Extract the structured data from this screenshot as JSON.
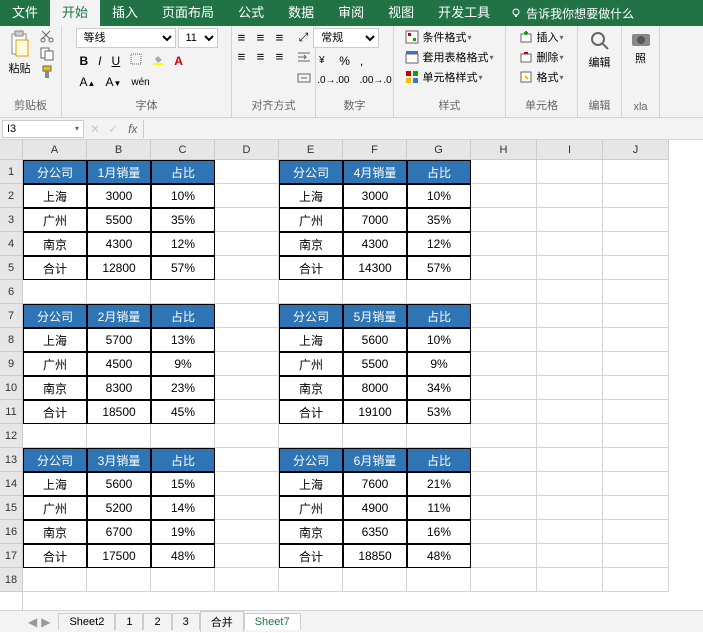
{
  "tabs": {
    "file": "文件",
    "home": "开始",
    "insert": "插入",
    "page": "页面布局",
    "formula": "公式",
    "data": "数据",
    "review": "审阅",
    "view": "视图",
    "dev": "开发工具",
    "tellme": "告诉我你想要做什么"
  },
  "groups": {
    "clipboard": "剪贴板",
    "font": "字体",
    "align": "对齐方式",
    "number": "数字",
    "styles": "样式",
    "cells": "单元格",
    "edit": "编辑",
    "xla": "xla"
  },
  "ribbon": {
    "paste": "粘贴",
    "font_name": "等线",
    "font_size": "11",
    "number_format": "常规",
    "cond_format": "条件格式",
    "table_format": "套用表格格式",
    "cell_styles": "单元格样式",
    "insert": "插入",
    "delete": "删除",
    "format": "格式",
    "edit": "编辑",
    "photo": "照"
  },
  "namebox": "I3",
  "colW": {
    "A": 64,
    "B": 64,
    "C": 64,
    "D": 64,
    "E": 64,
    "F": 64,
    "G": 64,
    "H": 66,
    "I": 66,
    "J": 66
  },
  "cols": [
    "A",
    "B",
    "C",
    "D",
    "E",
    "F",
    "G",
    "H",
    "I",
    "J"
  ],
  "rowCount": 18,
  "headers": {
    "company": "分公司",
    "sales1": "1月销量",
    "sales2": "2月销量",
    "sales3": "3月销量",
    "sales4": "4月销量",
    "sales5": "5月销量",
    "sales6": "6月销量",
    "ratio": "占比"
  },
  "cities": {
    "sh": "上海",
    "gz": "广州",
    "nj": "南京",
    "total": "合计"
  },
  "t1": {
    "month": "1月销量",
    "rows": [
      [
        "上海",
        "3000",
        "10%"
      ],
      [
        "广州",
        "5500",
        "35%"
      ],
      [
        "南京",
        "4300",
        "12%"
      ],
      [
        "合计",
        "12800",
        "57%"
      ]
    ]
  },
  "t2": {
    "month": "2月销量",
    "rows": [
      [
        "上海",
        "5700",
        "13%"
      ],
      [
        "广州",
        "4500",
        "9%"
      ],
      [
        "南京",
        "8300",
        "23%"
      ],
      [
        "合计",
        "18500",
        "45%"
      ]
    ]
  },
  "t3": {
    "month": "3月销量",
    "rows": [
      [
        "上海",
        "5600",
        "15%"
      ],
      [
        "广州",
        "5200",
        "14%"
      ],
      [
        "南京",
        "6700",
        "19%"
      ],
      [
        "合计",
        "17500",
        "48%"
      ]
    ]
  },
  "t4": {
    "month": "4月销量",
    "rows": [
      [
        "上海",
        "3000",
        "10%"
      ],
      [
        "广州",
        "7000",
        "35%"
      ],
      [
        "南京",
        "4300",
        "12%"
      ],
      [
        "合计",
        "14300",
        "57%"
      ]
    ]
  },
  "t5": {
    "month": "5月销量",
    "rows": [
      [
        "上海",
        "5600",
        "10%"
      ],
      [
        "广州",
        "5500",
        "9%"
      ],
      [
        "南京",
        "8000",
        "34%"
      ],
      [
        "合计",
        "19100",
        "53%"
      ]
    ]
  },
  "t6": {
    "month": "6月销量",
    "rows": [
      [
        "上海",
        "7600",
        "21%"
      ],
      [
        "广州",
        "4900",
        "11%"
      ],
      [
        "南京",
        "6350",
        "16%"
      ],
      [
        "合计",
        "18850",
        "48%"
      ]
    ]
  },
  "sheets": {
    "s2": "Sheet2",
    "s1": "1",
    "s2b": "2",
    "s3": "3",
    "merge": "合并",
    "s7": "Sheet7"
  }
}
